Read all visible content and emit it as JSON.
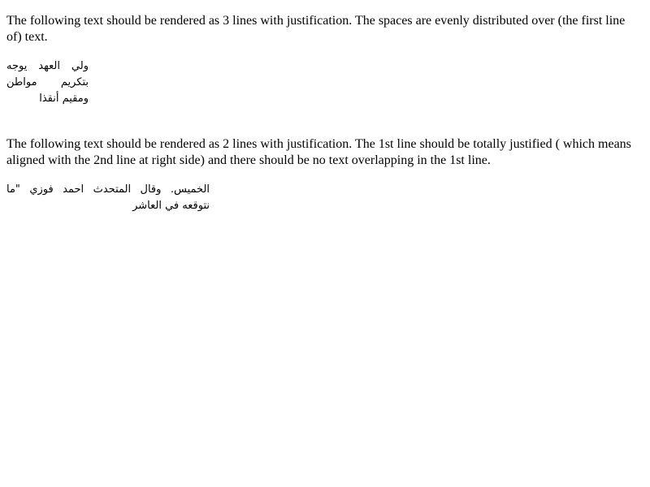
{
  "section1": {
    "description": "The following text should be rendered as 3 lines with justification. The spaces are evenly distributed over (the first line of) text.",
    "arabic_text": "ولي العهد يوجه بتكريم مواطن ومقيم أنقذا"
  },
  "section2": {
    "description": "The following text should be rendered as 2 lines with justification. The 1st line should be totally justified ( which means aligned with the 2nd line at right side) and there should be no text overlapping in the 1st line.",
    "arabic_text": "الخميس. وقال المتحدث احمد فوزي \"ما نتوقعه في العاشر"
  }
}
